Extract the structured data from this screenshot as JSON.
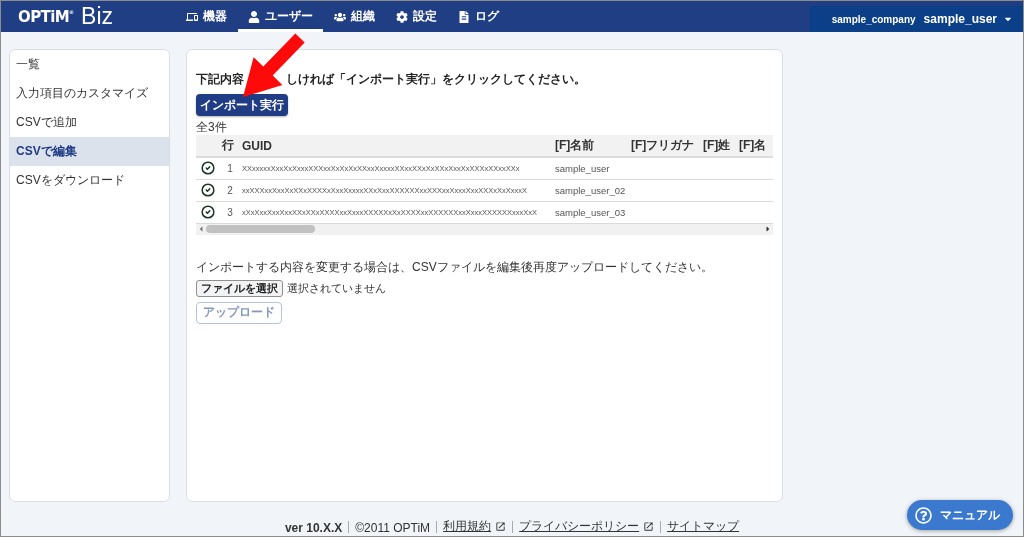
{
  "header": {
    "logo": {
      "brand": "OPTiM$^{®}$",
      "product": "Biz"
    },
    "nav": [
      {
        "label": "機器",
        "selected": false
      },
      {
        "label": "ユーザー",
        "selected": true
      },
      {
        "label": "組織",
        "selected": false
      },
      {
        "label": "設定",
        "selected": false
      },
      {
        "label": "ログ",
        "selected": false
      }
    ],
    "account": {
      "company": "sample_company",
      "user": "sample_user"
    }
  },
  "sidebar": {
    "items": [
      {
        "label": "一覧",
        "selected": false
      },
      {
        "label": "入力項目のカスタマイズ",
        "selected": false
      },
      {
        "label": "CSVで追加",
        "selected": false
      },
      {
        "label": "CSVで編集",
        "selected": true
      },
      {
        "label": "CSVをダウンロード",
        "selected": false
      }
    ]
  },
  "main": {
    "instruction": {
      "text_before_arrow": "下記内容",
      "text_after_arrow": "しければ「インポート実行」をクリックしてください。"
    },
    "import_button": "インポート実行",
    "count": "全3件",
    "table": {
      "columns": [
        "行",
        "GUID",
        "[F]名前",
        "[F]フリガナ",
        "[F]姓",
        "[F]名"
      ],
      "rows": [
        {
          "ok": true,
          "row": "1",
          "guid": "XXxxxxxXxxXxXxxxXXXxxXxXxXxXXxxXxxxxXXxxXXxXxXXxXxxXxXXXxXXxxXXx",
          "name": "sample_user"
        },
        {
          "ok": true,
          "row": "2",
          "guid": "xxXXXxxXxxXxXXxXXXXxXxxXxxxxXXxXxxXXXXXXxxXXXxxXxxxXxxXXXxXxXxxxX",
          "name": "sample_user_02"
        },
        {
          "ok": true,
          "row": "3",
          "guid": "xXxXxxXxxXxxXXxXXxXXXXxxXxxxXXXXXxXxXXXXxxXXXXXXxxXxxxXXXXXXxxxXxX",
          "name": "sample_user_03"
        }
      ]
    },
    "note": "インポートする内容を変更する場合は、CSVファイルを編集後再度アップロードしてください。",
    "file_input": {
      "button": "ファイルを選択",
      "status": "選択されていません"
    },
    "upload_button": {
      "label": "アップロード",
      "disabled": true
    }
  },
  "footer": {
    "items": [
      {
        "kind": "version",
        "label": "ver 10.X.X"
      },
      {
        "kind": "text",
        "label": "©2011 OPTiM"
      },
      {
        "kind": "link",
        "label": "利用規約",
        "external": true
      },
      {
        "kind": "link",
        "label": "プライバシーポリシー",
        "external": true
      },
      {
        "kind": "link",
        "label": "サイトマップ",
        "external": false
      }
    ]
  },
  "manual_button": "マニュアル"
}
